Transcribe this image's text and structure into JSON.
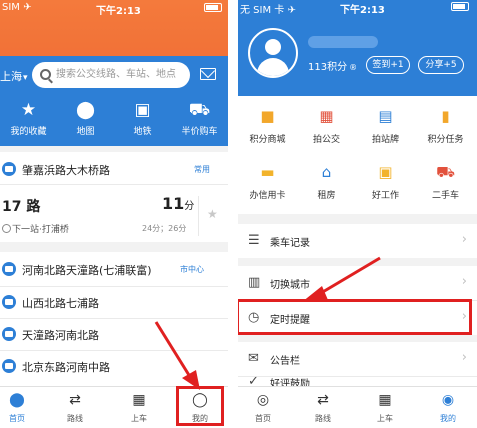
{
  "left": {
    "status": {
      "carrier": "SIM ✈",
      "time": "下午2:13"
    },
    "city": "上海",
    "search_placeholder": "搜索公交线路、车站、地点",
    "quick": [
      {
        "icon": "star-icon",
        "glyph": "★",
        "label": "我的收藏"
      },
      {
        "icon": "map-pin-icon",
        "glyph": "⬤",
        "label": "地图"
      },
      {
        "icon": "subway-icon",
        "glyph": "▣",
        "label": "地铁"
      },
      {
        "icon": "car-icon",
        "glyph": "⛟",
        "label": "半价购车"
      }
    ],
    "fav_stop": {
      "name": "肇嘉浜路大木桥路",
      "tag": "常用"
    },
    "route": {
      "number": "17 路",
      "minutes": "11",
      "unit": "分",
      "next": "下一站·打浦桥",
      "eta": "24分；26分"
    },
    "stops": [
      {
        "name": "河南北路天潼路(七浦联富)",
        "tag": "市中心"
      },
      {
        "name": "山西北路七浦路",
        "tag": ""
      },
      {
        "name": "天潼路河南北路",
        "tag": ""
      },
      {
        "name": "北京东路河南中路",
        "tag": ""
      }
    ],
    "tabs": [
      {
        "icon": "home-pin-icon",
        "glyph": "⬤",
        "label": "首页",
        "active": true
      },
      {
        "icon": "route-icon",
        "glyph": "⇄",
        "label": "路线",
        "active": false
      },
      {
        "icon": "bus-icon",
        "glyph": "▦",
        "label": "上车",
        "active": false
      },
      {
        "icon": "user-icon",
        "glyph": "◯",
        "label": "我的",
        "active": false
      }
    ]
  },
  "right": {
    "status": {
      "carrier": "无 SIM 卡 ✈",
      "time": "下午2:13"
    },
    "points": "113积分",
    "checkin_label": "签到+1",
    "share_label": "分享+5",
    "grid": [
      {
        "icon": "gift-icon",
        "glyph": "🎁",
        "label": "积分商城",
        "color": "#f2a72b"
      },
      {
        "icon": "bus-front-icon",
        "glyph": "▦",
        "label": "拍公交",
        "color": "#e2513c"
      },
      {
        "icon": "bus-stop-sign-icon",
        "glyph": "▤",
        "label": "拍站牌",
        "color": "#2d7fd6"
      },
      {
        "icon": "bookmark-icon",
        "glyph": "▮",
        "label": "积分任务",
        "color": "#f2a72b"
      },
      {
        "icon": "credit-card-icon",
        "glyph": "▬",
        "label": "办信用卡",
        "color": "#f2b32b"
      },
      {
        "icon": "house-icon",
        "glyph": "⌂",
        "label": "租房",
        "color": "#2d7fd6"
      },
      {
        "icon": "briefcase-icon",
        "glyph": "▣",
        "label": "好工作",
        "color": "#f2b32b"
      },
      {
        "icon": "car-icon",
        "glyph": "⛟",
        "label": "二手车",
        "color": "#e2513c"
      }
    ],
    "menu": [
      {
        "icon": "list-icon",
        "glyph": "☰",
        "label": "乘车记录"
      },
      {
        "icon": "city-icon",
        "glyph": "▥",
        "label": "切换城市"
      },
      {
        "icon": "alarm-clock-icon",
        "glyph": "⏰",
        "label": "定时提醒"
      },
      {
        "icon": "mail-icon",
        "glyph": "✉",
        "label": "公告栏"
      },
      {
        "icon": "thumbs-up-icon",
        "glyph": "👍",
        "label": "好评鼓励"
      }
    ],
    "tabs": [
      {
        "icon": "home-pin-icon",
        "glyph": "⬤",
        "label": "首页",
        "active": false
      },
      {
        "icon": "route-icon",
        "glyph": "⇄",
        "label": "路线",
        "active": false
      },
      {
        "icon": "bus-icon",
        "glyph": "▦",
        "label": "上车",
        "active": false
      },
      {
        "icon": "user-icon",
        "glyph": "◉",
        "label": "我的",
        "active": true
      }
    ]
  },
  "colors": {
    "brand_blue": "#2d7fd6",
    "banner_orange": "#ef6a33",
    "highlight_red": "#e02020"
  }
}
